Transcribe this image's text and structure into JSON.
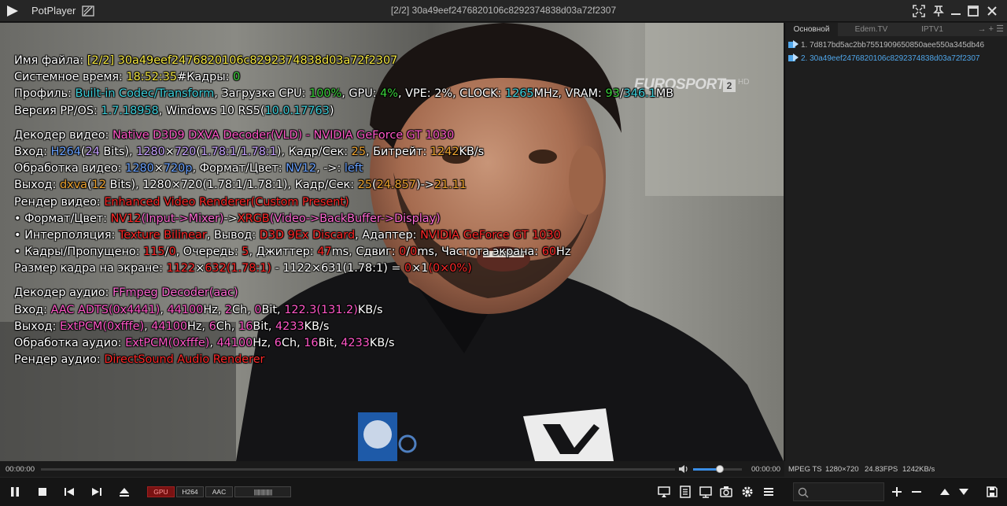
{
  "app": {
    "name": "PotPlayer",
    "window_title": "[2/2] 30a49eef2476820106c8292374838d03a72f2307"
  },
  "video": {
    "channel_logo": "EUROSPORT",
    "channel_number": "2",
    "channel_suffix": "HD"
  },
  "osd": {
    "file": {
      "label": "Имя файла: ",
      "index": "[2/2]",
      "name": "30a49eef2476820106c8292374838d03a72f2307"
    },
    "system": {
      "label": "Системное время: ",
      "time": "18:52:35",
      "frames_label": "#Кадры: ",
      "frames": "0"
    },
    "profile": {
      "label": "Профиль: ",
      "profile": "Built-in Codec/Transform",
      "cpu_label": ", Загрузка CPU: ",
      "cpu": "100%",
      "gpu_label": ", GPU: ",
      "gpu": "4%",
      "vpe_label": ", VPE: ",
      "vpe": "2%",
      "clock_label": ", CLOCK: ",
      "clock": "1265",
      "mhz": "MHz",
      "vram_label": ", VRAM: ",
      "vram_used": "93",
      "slash": "/",
      "vram_total": "346.1",
      "mb": "MB"
    },
    "version": {
      "label": "Версия PP/OS: ",
      "pp": "1.7.18958",
      "os_label": ", Windows 10 RS5(",
      "os_build": "10.0.17763",
      "close": ")"
    },
    "vdec": {
      "label": "Декодер видео: ",
      "value": "Native D3D9 DXVA Decoder(VLD) - NVIDIA GeForce GT 1030"
    },
    "vin": {
      "label": "Вход: ",
      "codec": "H264",
      "bits_open": "(",
      "bits": "24",
      "bits_close": " Bits), ",
      "w": "1280",
      "x": "×",
      "h": "720",
      "ar_open": "(",
      "ar1": "1.78:1",
      "ar_slash": "/",
      "ar2": "1.78:1",
      "ar_close": ")",
      "fps_label": ", Кадр/Сек: ",
      "fps": "25",
      "br_label": ", Битрейт: ",
      "br": "1242",
      "kbs": "KB/s"
    },
    "vproc": {
      "label": "Обработка видео: ",
      "w": "1280",
      "x": "×",
      "h": "720p",
      "fmt_label": ", Формат/Цвет: ",
      "fmt": "NV12",
      "arrow": ", ->: ",
      "dir": "left"
    },
    "vout": {
      "label": "Выход: ",
      "out": "dxva",
      "bits_open": "(",
      "bits": "12",
      "mid": " Bits), 1280×720(1.78:1/1.78:1), Кадр/Сек: ",
      "fps1": "25",
      "fps2_open": "(",
      "fps2": "24.857",
      "arrow": ")->",
      "fps3": "21.11"
    },
    "vrend": {
      "label": "Рендер видео: ",
      "value": "Enhanced Video Renderer(Custom Present)"
    },
    "fmt": {
      "label": "• Формат/Цвет: ",
      "a": "NV12",
      "a2": "(Input->Mixer)",
      "arrow": "->",
      "b": "XRGB",
      "b2": "(Video->BackBuffer->Display)"
    },
    "interp": {
      "label": "• Интерполяция: ",
      "interp": "Texture Bilinear",
      "out_label": ", Вывод: ",
      "out": "D3D 9Ex Discard",
      "ad_label": ", Адаптер: ",
      "adapter": "NVIDIA GeForce GT 1030"
    },
    "frames": {
      "label": "• Кадры/Пропущено: ",
      "f": "115",
      "slash": "/",
      "d": "0",
      "q_label": ", Очередь: ",
      "q": "5",
      "j_label": ", Джиттер: ",
      "j": "47",
      "ms1": "ms, Сдвиг: ",
      "s1": "0",
      "slash2": "/",
      "s2": "0",
      "ms2": "ms, Частота экрана: ",
      "hz": "60",
      "hz_unit": "Hz"
    },
    "size": {
      "label": "Размер кадра на экране: ",
      "w1": "1122",
      "x": "×",
      "h1": "632",
      "ar1": "(1.78:1)",
      "dash": " - ",
      "w2": "1122",
      "h2": "631",
      "ar2": "(1.78:1)",
      "eq": " = ",
      "dw": "0",
      "dh": "1",
      "dp": "(0×0%)"
    },
    "adec": {
      "label": "Декодер аудио: ",
      "value": "FFmpeg Decoder(aac)"
    },
    "ain": {
      "label": "Вход: ",
      "codec": "AAC ADTS",
      "tag": "(0x4441)",
      "sep": ", ",
      "hz": "44100",
      "hz_u": "Hz, ",
      "ch": "2",
      "ch_u": "Ch, ",
      "bit": "0",
      "bit_u": "Bit, ",
      "br": "122.3",
      "br2": "(131.2)",
      "kbs": "KB/s"
    },
    "aout": {
      "label": "Выход: ",
      "codec": "ExtPCM",
      "tag": "(0xfffe)",
      "sep": ", ",
      "hz": "44100",
      "hz_u": "Hz, ",
      "ch": "6",
      "ch_u": "Ch, ",
      "bit": "16",
      "bit_u": "Bit, ",
      "br": "4233",
      "kbs": "KB/s"
    },
    "aproc": {
      "label": "Обработка аудио: ",
      "codec": "ExtPCM",
      "tag": "(0xfffe)",
      "sep": ", ",
      "hz": "44100",
      "hz_u": "Hz, ",
      "ch": "6",
      "ch_u": "Ch, ",
      "bit": "16",
      "bit_u": "Bit, ",
      "br": "4233",
      "kbs": "KB/s"
    },
    "arend": {
      "label": "Рендер аудио: ",
      "value": "DirectSound Audio Renderer"
    }
  },
  "playlist": {
    "tabs": [
      "Основной",
      "Edem.TV",
      "IPTV1"
    ],
    "tab_extra": "→ + ☰",
    "items": [
      "1. 7d817bd5ac2bb7551909650850aee550a345db46",
      "2. 30a49eef2476820106c8292374838d03a72f2307"
    ]
  },
  "seek": {
    "time_current": "00:00:00",
    "time_total": "00:00:00",
    "volume_level": 0.55
  },
  "stream_info": {
    "format": "MPEG TS",
    "resolution": "1280×720",
    "fps": "24.83FPS",
    "bitrate": "1242KB/s"
  },
  "badges": {
    "gpu": "GPU",
    "h264": "H264",
    "aac": "AAC",
    "meter": "|||||||||||||||||||"
  },
  "colors": {
    "accent": "#3a8ee6",
    "playing": "#4fa6ea",
    "gpu_badge": "#7a1212"
  }
}
